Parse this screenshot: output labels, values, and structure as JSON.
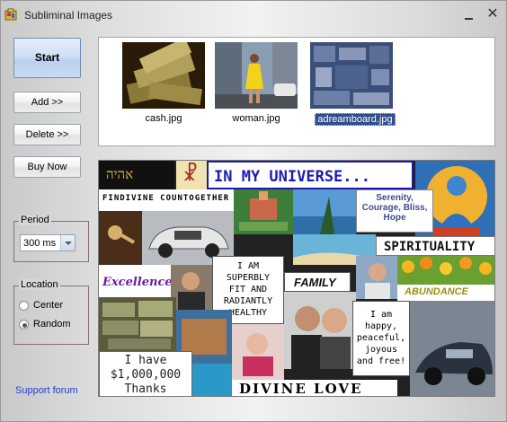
{
  "window": {
    "title": "Subliminal Images"
  },
  "buttons": {
    "start": "Start",
    "add": "Add  >>",
    "delete": "Delete >>",
    "buy": "Buy Now"
  },
  "period": {
    "label": "Period",
    "value": "300 ms"
  },
  "location": {
    "label": "Location",
    "options": [
      "Center",
      "Random"
    ],
    "selected": "Random"
  },
  "links": {
    "support": "Support forum"
  },
  "images": [
    {
      "name": "cash.jpg",
      "selected": false
    },
    {
      "name": "woman.jpg",
      "selected": false
    },
    {
      "name": "adreamboard.jpg",
      "selected": true
    }
  ],
  "collage": {
    "hebrew": "אהיה",
    "universe": "IN MY UNIVERSE...",
    "findivine": "FINDIVINE COUNTOGETHER",
    "serenity": "Serenity, Courage, Bliss, Hope",
    "spirituality": "SPIRITUALITY",
    "excellence": "Excellence",
    "fit": "I AM SUPERBLY FIT AND RADIANTLY HEALTHY",
    "family": "FAMILY",
    "abundance": "ABUNDANCE",
    "happy": "I am happy, peaceful, joyous and free!",
    "million": "I have $1,000,000 Thanks",
    "divine": "DIVINE LOVE"
  },
  "colors": {
    "link": "#1c3fd0",
    "selection": "#2d4d8c",
    "start_button": "#c8dbf3"
  }
}
